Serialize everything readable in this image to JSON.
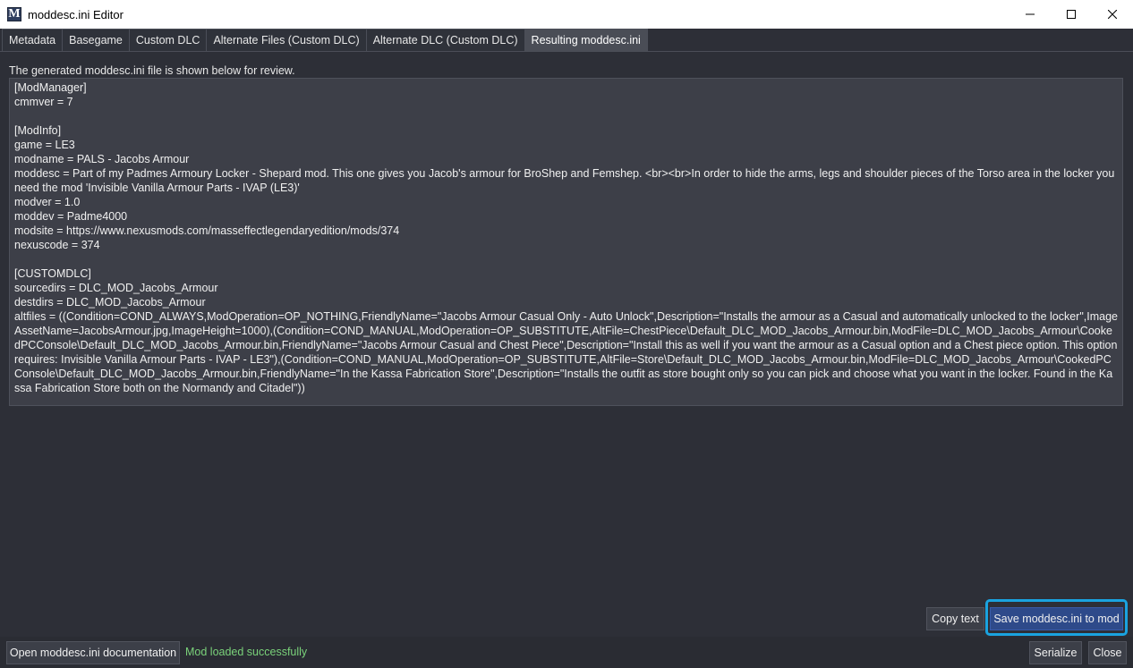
{
  "window": {
    "title": "moddesc.ini Editor",
    "icon_letter": "M"
  },
  "tabs": [
    {
      "label": "Metadata",
      "active": false
    },
    {
      "label": "Basegame",
      "active": false
    },
    {
      "label": "Custom DLC",
      "active": false
    },
    {
      "label": "Alternate Files (Custom DLC)",
      "active": false
    },
    {
      "label": "Alternate DLC (Custom DLC)",
      "active": false
    },
    {
      "label": "Resulting moddesc.ini",
      "active": true
    }
  ],
  "main": {
    "description": "The generated moddesc.ini file is shown below for review.",
    "ini_text": "[ModManager]\ncmmver = 7\n\n[ModInfo]\ngame = LE3\nmodname = PALS - Jacobs Armour\nmoddesc = Part of my Padmes Armoury Locker - Shepard mod. This one gives you Jacob's armour for BroShep and Femshep. <br><br>In order to hide the arms, legs and shoulder pieces of the Torso area in the locker you need the mod 'Invisible Vanilla Armour Parts - IVAP (LE3)'\nmodver = 1.0\nmoddev = Padme4000\nmodsite = https://www.nexusmods.com/masseffectlegendaryedition/mods/374\nnexuscode = 374\n\n[CUSTOMDLC]\nsourcedirs = DLC_MOD_Jacobs_Armour\ndestdirs = DLC_MOD_Jacobs_Armour\naltfiles = ((Condition=COND_ALWAYS,ModOperation=OP_NOTHING,FriendlyName=\"Jacobs Armour Casual Only - Auto Unlock\",Description=\"Installs the armour as a Casual and automatically unlocked to the locker\",ImageAssetName=JacobsArmour.jpg,ImageHeight=1000),(Condition=COND_MANUAL,ModOperation=OP_SUBSTITUTE,AltFile=ChestPiece\\Default_DLC_MOD_Jacobs_Armour.bin,ModFile=DLC_MOD_Jacobs_Armour\\CookedPCConsole\\Default_DLC_MOD_Jacobs_Armour.bin,FriendlyName=\"Jacobs Armour Casual and Chest Piece\",Description=\"Install this as well if you want the armour as a Casual option and a Chest piece option. This option requires: Invisible Vanilla Armour Parts - IVAP - LE3\"),(Condition=COND_MANUAL,ModOperation=OP_SUBSTITUTE,AltFile=Store\\Default_DLC_MOD_Jacobs_Armour.bin,ModFile=DLC_MOD_Jacobs_Armour\\CookedPCConsole\\Default_DLC_MOD_Jacobs_Armour.bin,FriendlyName=\"In the Kassa Fabrication Store\",Description=\"Installs the outfit as store bought only so you can pick and choose what you want in the locker. Found in the Kassa Fabrication Store both on the Normandy and Citadel\"))"
  },
  "actions": {
    "copy_text": "Copy text",
    "save_to_mod": "Save moddesc.ini to mod"
  },
  "footer": {
    "documentation": "Open moddesc.ini documentation",
    "status": "Mod loaded successfully",
    "serialize": "Serialize",
    "close": "Close"
  },
  "colors": {
    "background": "#2d2f37",
    "editor_background": "#3d3f48",
    "active_tab": "#4a4d56",
    "primary_button": "#2e4a8a",
    "highlight": "#1aa3e0",
    "status_green": "#7ad27a"
  }
}
